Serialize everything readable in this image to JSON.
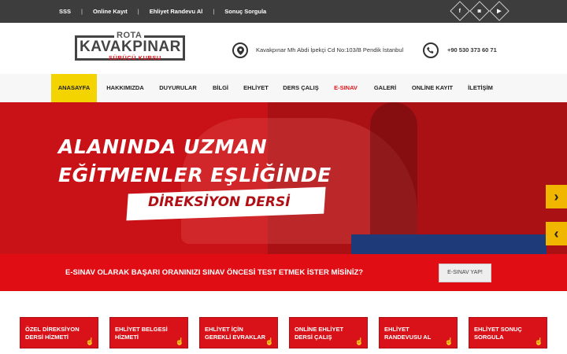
{
  "topbar": {
    "links": [
      "SSS",
      "Online Kayıt",
      "Ehliyet Randevu Al",
      "Sonuç Sorgula"
    ],
    "separator": "|",
    "social": [
      {
        "icon": "facebook-icon",
        "glyph": "f"
      },
      {
        "icon": "instagram-icon",
        "glyph": "◙"
      },
      {
        "icon": "youtube-icon",
        "glyph": "▶"
      }
    ]
  },
  "header": {
    "logo": {
      "rota": "ROTA",
      "main": "KAVAKPINAR",
      "sub": "SÜRÜCÜ KURSU"
    },
    "address": "Kavakpınar Mh Abdi İpekçi Cd No:103/B Pendik İstanbul",
    "phone": "+90 530 373 60 71"
  },
  "nav": [
    "ANASAYFA",
    "HAKKIMIZDA",
    "DUYURULAR",
    "BİLGİ",
    "EHLİYET",
    "DERS ÇALIŞ",
    "E-SINAV",
    "GALERİ",
    "ONLİNE KAYIT",
    "İLETİŞİM"
  ],
  "hero": {
    "line1": "ALANINDA UZMAN",
    "line2": "EĞİTMENLER EŞLİĞİNDE",
    "badge": "DİREKSİYON DERSİ",
    "next": "›",
    "prev": "‹"
  },
  "cta": {
    "text": "E-SINAV OLARAK BAŞARI ORANINIZI SINAV ÖNCESİ TEST ETMEK İSTER MİSİNİZ?",
    "button": "E-SINAV YAP!"
  },
  "cards": [
    {
      "l1": "ÖZEL DİREKSİYON",
      "l2": "DERSİ HİZMETİ"
    },
    {
      "l1": "EHLİYET BELGESİ",
      "l2": "HİZMETİ"
    },
    {
      "l1": "EHLİYET İÇİN",
      "l2": "GEREKLİ EVRAKLAR"
    },
    {
      "l1": "ONLİNE EHLİYET",
      "l2": "DERSİ ÇALIŞ"
    },
    {
      "l1": "EHLİYET",
      "l2": "RANDEVUSU AL"
    },
    {
      "l1": "EHLİYET SONUÇ",
      "l2": "SORGULA"
    }
  ],
  "colors": {
    "accent": "#f3d300",
    "brand_red": "#e00d14",
    "dark": "#3d3d3d"
  }
}
